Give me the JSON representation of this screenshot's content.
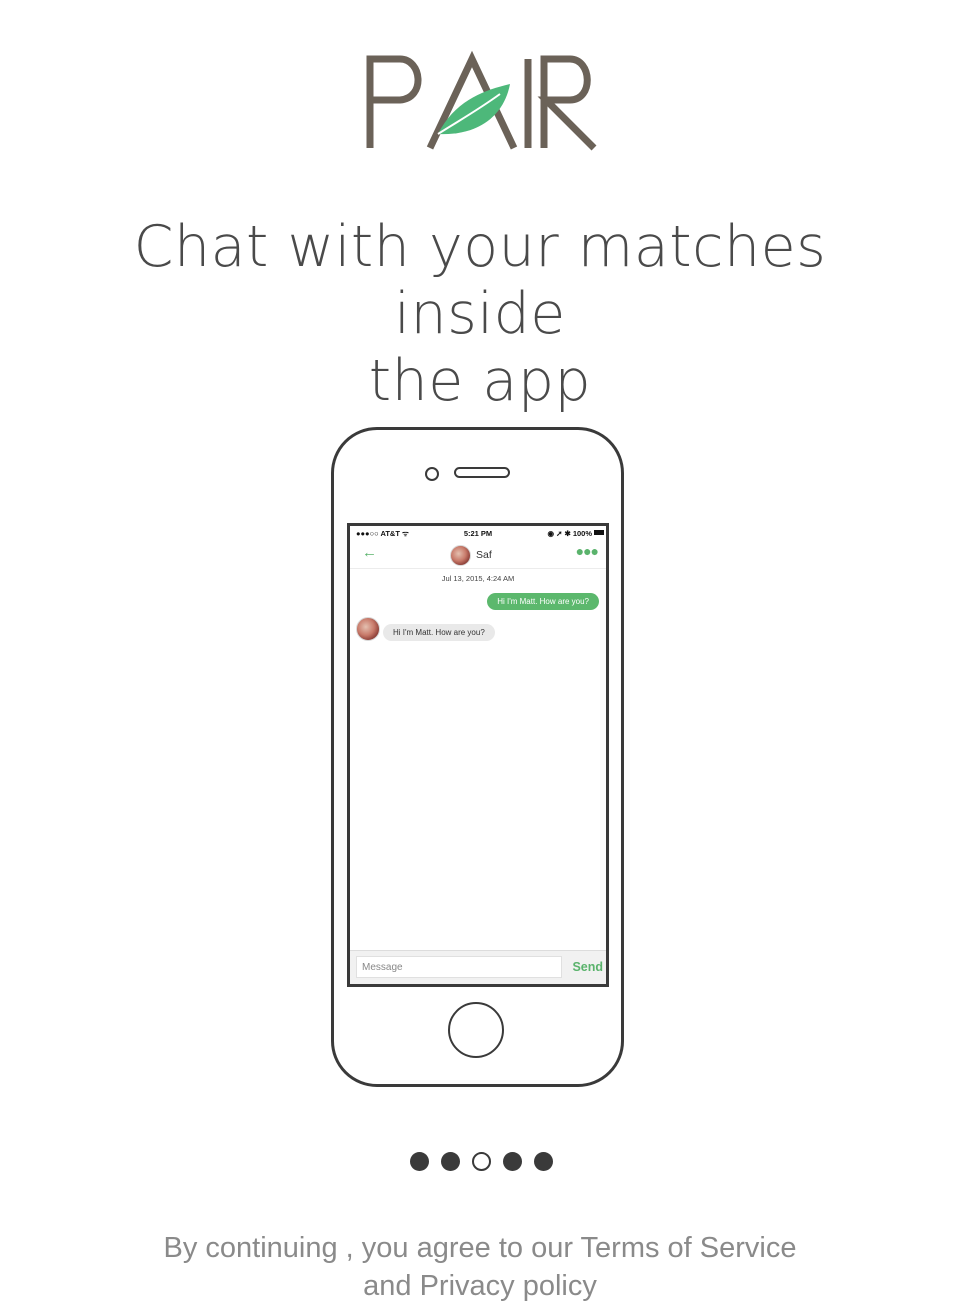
{
  "logo": {
    "text": "PAIR",
    "accent_color": "#4db87a"
  },
  "headline": {
    "line1": "Chat with your matches inside",
    "line2": "the app"
  },
  "phone_screen": {
    "status": {
      "carrier": "●●●○○ AT&T ᯤ",
      "time": "5:21 PM",
      "right": "◉ ➚ ✱ 100%"
    },
    "nav": {
      "back_icon": "←",
      "contact_name": "Saf",
      "more_icon": "●●●"
    },
    "date": "Jul 13, 2015, 4:24 AM",
    "messages": [
      {
        "direction": "outgoing",
        "text": "Hi I'm Matt. How are you?"
      },
      {
        "direction": "incoming",
        "text": "Hi I'm Matt. How are you?"
      }
    ],
    "composer": {
      "placeholder": "Message",
      "send_label": "Send"
    }
  },
  "pagination": {
    "total": 5,
    "active_index": 3
  },
  "footer": {
    "line1": "By continuing , you agree to our Terms of Service",
    "line2": "and Privacy policy"
  }
}
